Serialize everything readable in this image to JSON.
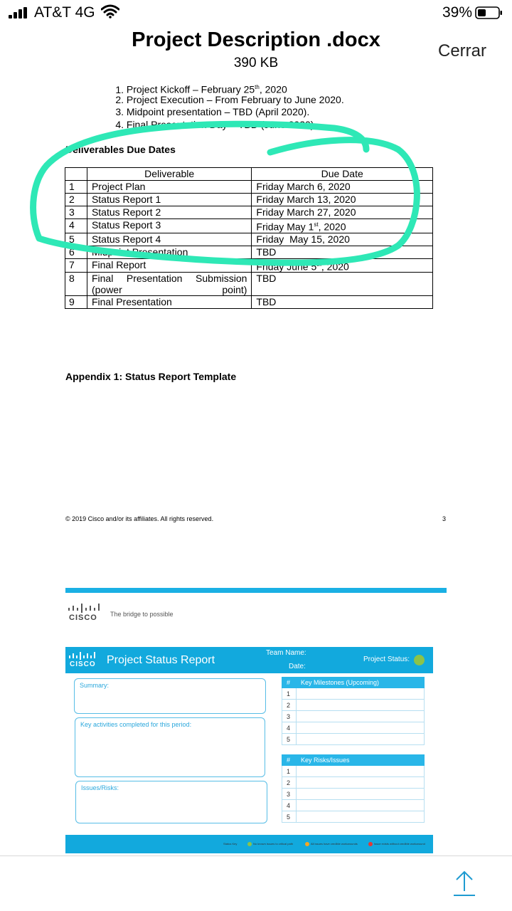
{
  "status_bar": {
    "carrier": "AT&T 4G",
    "battery": "39%",
    "icons": [
      "signal-icon",
      "wifi-icon",
      "battery-icon"
    ]
  },
  "header": {
    "title": "Project Description .docx",
    "size": "390 KB",
    "close_label": "Cerrar"
  },
  "document": {
    "milestones": [
      {
        "num": "1.",
        "text": "Project Kickoff – February 25",
        "sup": "th",
        "tail": ", 2020"
      },
      {
        "num": "2.",
        "text": "Project Execution – From February to June 2020.",
        "sup": "",
        "tail": ""
      },
      {
        "num": "3.",
        "text": "Midpoint presentation – TBD (April 2020).",
        "sup": "",
        "tail": ""
      },
      {
        "num": "4.",
        "text": "Final Presentation Day – TBD (June 2020).",
        "sup": "",
        "tail": ""
      }
    ],
    "deliverables_title": "Deliverables Due Dates",
    "table_headers": [
      "",
      "Deliverable",
      "Due Date"
    ],
    "rows": [
      {
        "n": "1",
        "deliverable": "Project Plan",
        "due": "Friday March 6, 2020",
        "sup": "",
        "tail": ""
      },
      {
        "n": "2",
        "deliverable": "Status Report 1",
        "due": "Friday March 13, 2020",
        "sup": "",
        "tail": ""
      },
      {
        "n": "3",
        "deliverable": "Status Report 2",
        "due": "Friday March 27, 2020",
        "sup": "",
        "tail": ""
      },
      {
        "n": "4",
        "deliverable": "Status Report 3",
        "due": "Friday May 1",
        "sup": "st",
        "tail": ", 2020"
      },
      {
        "n": "5",
        "deliverable": "Status Report 4",
        "due": "Friday  May 15, 2020",
        "sup": "",
        "tail": ""
      },
      {
        "n": "6",
        "deliverable": "Midpoint Presentation",
        "due": "TBD",
        "sup": "",
        "tail": ""
      },
      {
        "n": "7",
        "deliverable": "Final Report",
        "due": "Friday June 5",
        "sup": "th",
        "tail": ", 2020"
      },
      {
        "n": "8",
        "deliverable": "Final Presentation Submission (power point)",
        "due": "TBD",
        "sup": "",
        "tail": ""
      },
      {
        "n": "9",
        "deliverable": "Final Presentation",
        "due": "TBD",
        "sup": "",
        "tail": ""
      }
    ],
    "appendix_title": "Appendix 1: Status Report Template",
    "copyright": "© 2019 Cisco and/or its affiliates. All rights reserved.",
    "page_number": "3",
    "highlight_color": "#2ee8b6"
  },
  "template": {
    "brand": "CISCO",
    "tagline": "The bridge to possible",
    "report_title": "Project Status Report",
    "team_name_label": "Team Name:",
    "date_label": "Date:",
    "project_status_label": "Project Status:",
    "status_color": "#8bc34a",
    "summary_label": "Summary:",
    "activities_label": "Key activities completed for this period:",
    "issues_label": "Issues/Risks:",
    "milestones_table": {
      "hash": "#",
      "title": "Key Milestones (Upcoming)",
      "rows": [
        "1",
        "2",
        "3",
        "4",
        "5"
      ]
    },
    "risks_table": {
      "hash": "#",
      "title": "Key Risks/Issues",
      "rows": [
        "1",
        "2",
        "3",
        "4",
        "5"
      ]
    },
    "status_key": {
      "label": "Status Key",
      "items": [
        {
          "text": "No known issues to critical path",
          "color": "#8bc34a"
        },
        {
          "text": "All issues have credible workarounds",
          "color": "#f5a623"
        },
        {
          "text": "Issue exists without credible workaround",
          "color": "#e53935"
        }
      ]
    },
    "accent_color": "#12a9dd"
  },
  "toolbar": {
    "share_icon": "share-icon"
  }
}
